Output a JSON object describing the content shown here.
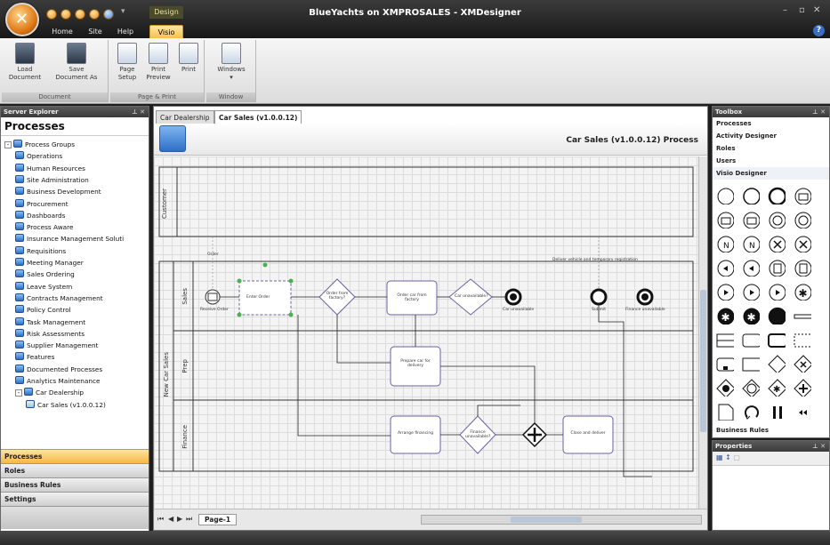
{
  "window": {
    "title": "BlueYachts on XMPROSALES - XMDesigner",
    "context_tab": "Design"
  },
  "ribbon": {
    "tabs": [
      {
        "label": "Home"
      },
      {
        "label": "Site"
      },
      {
        "label": "Help"
      },
      {
        "label": "Visio"
      }
    ],
    "groups": [
      {
        "caption": "Document",
        "buttons": [
          {
            "label": "Load\nDocument"
          },
          {
            "label": "Save\nDocument As"
          }
        ]
      },
      {
        "caption": "Page & Print",
        "buttons": [
          {
            "label": "Page\nSetup"
          },
          {
            "label": "Print\nPreview"
          },
          {
            "label": "Print"
          }
        ]
      },
      {
        "caption": "Window",
        "buttons": [
          {
            "label": "Windows"
          }
        ]
      }
    ]
  },
  "server_explorer": {
    "title": "Server Explorer",
    "heading": "Processes",
    "tree": [
      {
        "label": "Process Groups",
        "level": 0,
        "expander": "-"
      },
      {
        "label": "Operations",
        "level": 1
      },
      {
        "label": "Human Resources",
        "level": 1
      },
      {
        "label": "Site Administration",
        "level": 1
      },
      {
        "label": "Business Development",
        "level": 1
      },
      {
        "label": "Procurement",
        "level": 1
      },
      {
        "label": "Dashboards",
        "level": 1
      },
      {
        "label": "Process Aware",
        "level": 1
      },
      {
        "label": "Insurance Management Soluti",
        "level": 1
      },
      {
        "label": "Requisitions",
        "level": 1
      },
      {
        "label": "Meeting Manager",
        "level": 1
      },
      {
        "label": "Sales Ordering",
        "level": 1
      },
      {
        "label": "Leave System",
        "level": 1
      },
      {
        "label": "Contracts Management",
        "level": 1
      },
      {
        "label": "Policy Control",
        "level": 1
      },
      {
        "label": "Task Management",
        "level": 1
      },
      {
        "label": "Risk Assessments",
        "level": 1
      },
      {
        "label": "Supplier Management",
        "level": 1
      },
      {
        "label": "Features",
        "level": 1
      },
      {
        "label": "Documented Processes",
        "level": 1
      },
      {
        "label": "Analytics Maintenance",
        "level": 1
      },
      {
        "label": "Car Dealership",
        "level": 1,
        "expander": "-"
      },
      {
        "label": "Car Sales (v1.0.0.12)",
        "level": 2,
        "doc": true
      }
    ],
    "nav": [
      {
        "label": "Processes"
      },
      {
        "label": "Roles"
      },
      {
        "label": "Business Rules"
      },
      {
        "label": "Settings"
      }
    ]
  },
  "document": {
    "tabs": [
      {
        "label": "Car Dealership"
      },
      {
        "label": "Car Sales (v1.0.0.12)"
      }
    ],
    "title": "Car Sales (v1.0.0.12) Process",
    "page_tab": "Page-1",
    "diagram": {
      "pool": "New Car Sales",
      "lanes": [
        "Customer",
        "Sales",
        "Prep",
        "Finance"
      ],
      "activities": [
        "Enter Order",
        "Order car from factory",
        "Prepare car for delivery",
        "Arrange financing",
        "Close and deliver"
      ],
      "gateways": [
        "Order from factory?",
        "Car unavailable?",
        "Finance unavailable?"
      ],
      "events": [
        "Receive Order",
        "Car unavailable",
        "Submit",
        "Finance unavailable"
      ],
      "messages": [
        "Order",
        "Deliver vehicle and temporary registration"
      ]
    }
  },
  "toolbox": {
    "title": "Toolbox",
    "items": [
      {
        "label": "Processes"
      },
      {
        "label": "Activity Designer"
      },
      {
        "label": "Roles"
      },
      {
        "label": "Users"
      },
      {
        "label": "Visio Designer"
      }
    ],
    "footer": "Business Rules"
  },
  "properties": {
    "title": "Properties"
  }
}
